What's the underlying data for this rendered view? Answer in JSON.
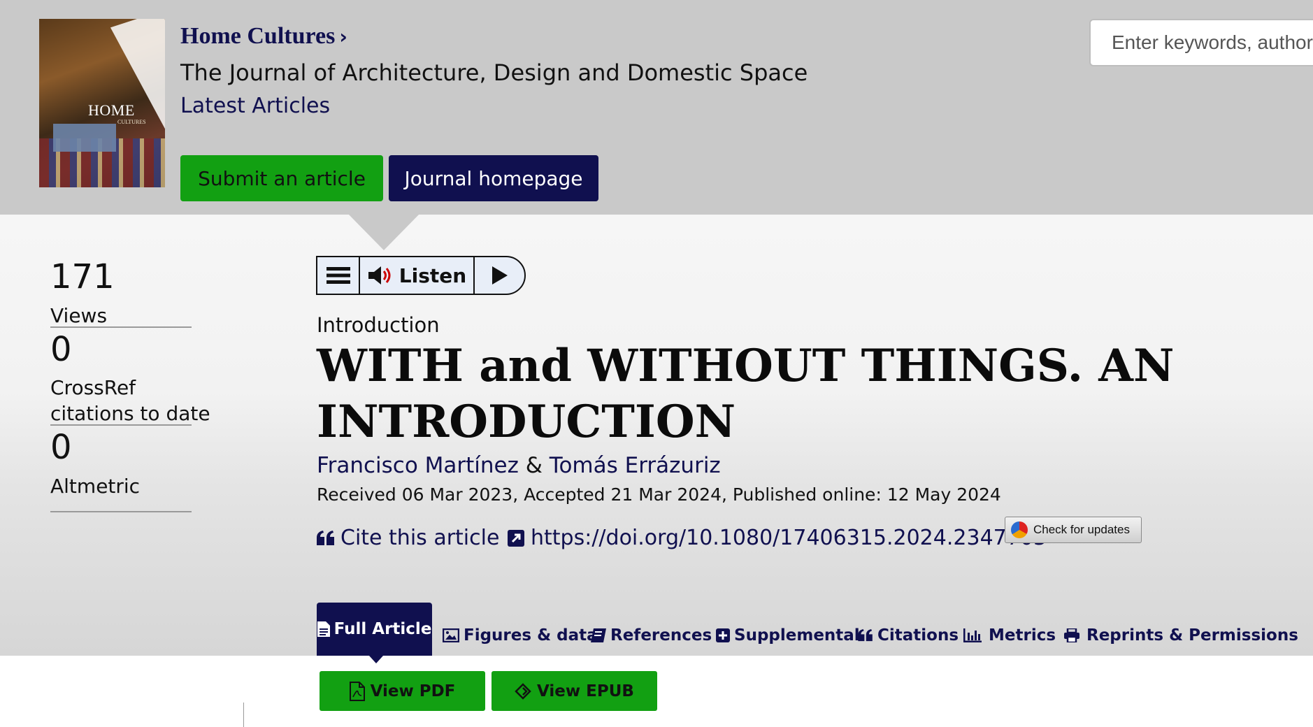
{
  "header": {
    "cover": {
      "title": "HOME",
      "subtitle": "CULTURES"
    },
    "journal_title": "Home Cultures",
    "journal_title_chevron": "›",
    "journal_subtitle": "The Journal of Architecture, Design and Domestic Space",
    "latest_articles": "Latest Articles",
    "submit_label": "Submit an article",
    "homepage_label": "Journal homepage",
    "search_placeholder": "Enter keywords, authors, DOI, ORCID etc"
  },
  "metrics": [
    {
      "value": "171",
      "label": "Views"
    },
    {
      "value": "0",
      "label": "CrossRef citations to date"
    },
    {
      "value": "0",
      "label": "Altmetric"
    }
  ],
  "listen": {
    "label": "Listen"
  },
  "article": {
    "type": "Introduction",
    "title": "WITH and WITHOUT THINGS. AN INTRODUCTION",
    "authors": [
      "Francisco Martínez",
      "Tomás Errázuriz"
    ],
    "author_separator": "&",
    "dates": "Received 06 Mar 2023, Accepted 21 Mar 2024, Published online: 12 May 2024",
    "cite_label": "Cite this article",
    "doi": "https://doi.org/10.1080/17406315.2024.2347703",
    "check_updates": "Check for updates"
  },
  "tabs": {
    "full_article": "Full Article",
    "figures": "Figures & data",
    "references": "References",
    "supplemental": "Supplemental",
    "citations": "Citations",
    "metrics": "Metrics",
    "reprints": "Reprints & Permissions"
  },
  "downloads": {
    "pdf": "View PDF",
    "epub": "View EPUB"
  },
  "colors": {
    "navy": "#10104f",
    "green": "#12a012",
    "header_gray": "#c9c9c9"
  }
}
